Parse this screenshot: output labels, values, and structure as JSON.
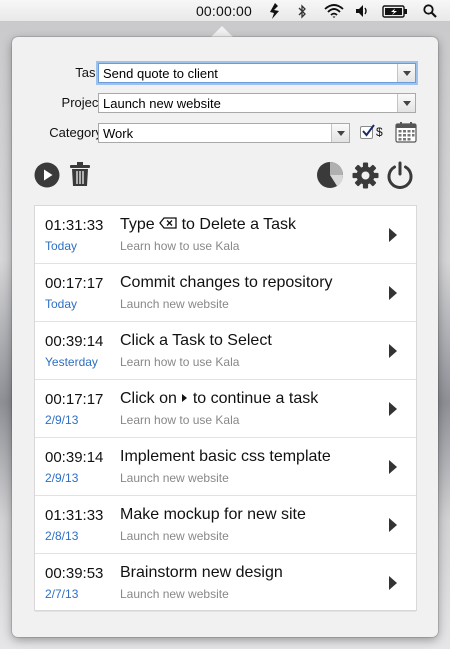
{
  "menubar": {
    "timer": "00:00:00",
    "icons": [
      "kala-icon",
      "bluetooth-icon",
      "wifi-icon",
      "volume-icon",
      "battery-icon",
      "spotlight-search-icon"
    ]
  },
  "form": {
    "task_label": "Task",
    "task_value": "Send quote to client",
    "project_label": "Project",
    "project_value": "Launch new website",
    "category_label": "Category",
    "category_value": "Work",
    "billable_label": "$",
    "billable_checked": true
  },
  "toolbar": {
    "left_icons": [
      "play-icon",
      "trash-icon"
    ],
    "right_icons": [
      "pie-chart-icon",
      "gear-icon",
      "power-icon"
    ]
  },
  "tasks": [
    {
      "time": "01:31:33",
      "date": "Today",
      "title_before": "Type ",
      "title_after": " to Delete a Task",
      "inline_icon": "delete-key-icon",
      "project": "Learn how to use Kala"
    },
    {
      "time": "00:17:17",
      "date": "Today",
      "title": "Commit changes to repository",
      "project": "Launch new website"
    },
    {
      "time": "00:39:14",
      "date": "Yesterday",
      "title": "Click a Task to Select",
      "project": "Learn how to use Kala"
    },
    {
      "time": "00:17:17",
      "date": "2/9/13",
      "title_before": "Click on ",
      "title_after": " to continue a task",
      "inline_icon": "play-triangle-icon",
      "project": "Learn how to use Kala"
    },
    {
      "time": "00:39:14",
      "date": "2/9/13",
      "title": "Implement basic css template",
      "project": "Launch new website"
    },
    {
      "time": "01:31:33",
      "date": "2/8/13",
      "title": "Make mockup for new site",
      "project": "Launch new website"
    },
    {
      "time": "00:39:53",
      "date": "2/7/13",
      "title": "Brainstorm new design",
      "project": "Launch new website"
    }
  ],
  "colors": {
    "date_blue": "#2e6fc4",
    "project_gray": "#888888",
    "focus_ring": "#9ec2ee"
  }
}
